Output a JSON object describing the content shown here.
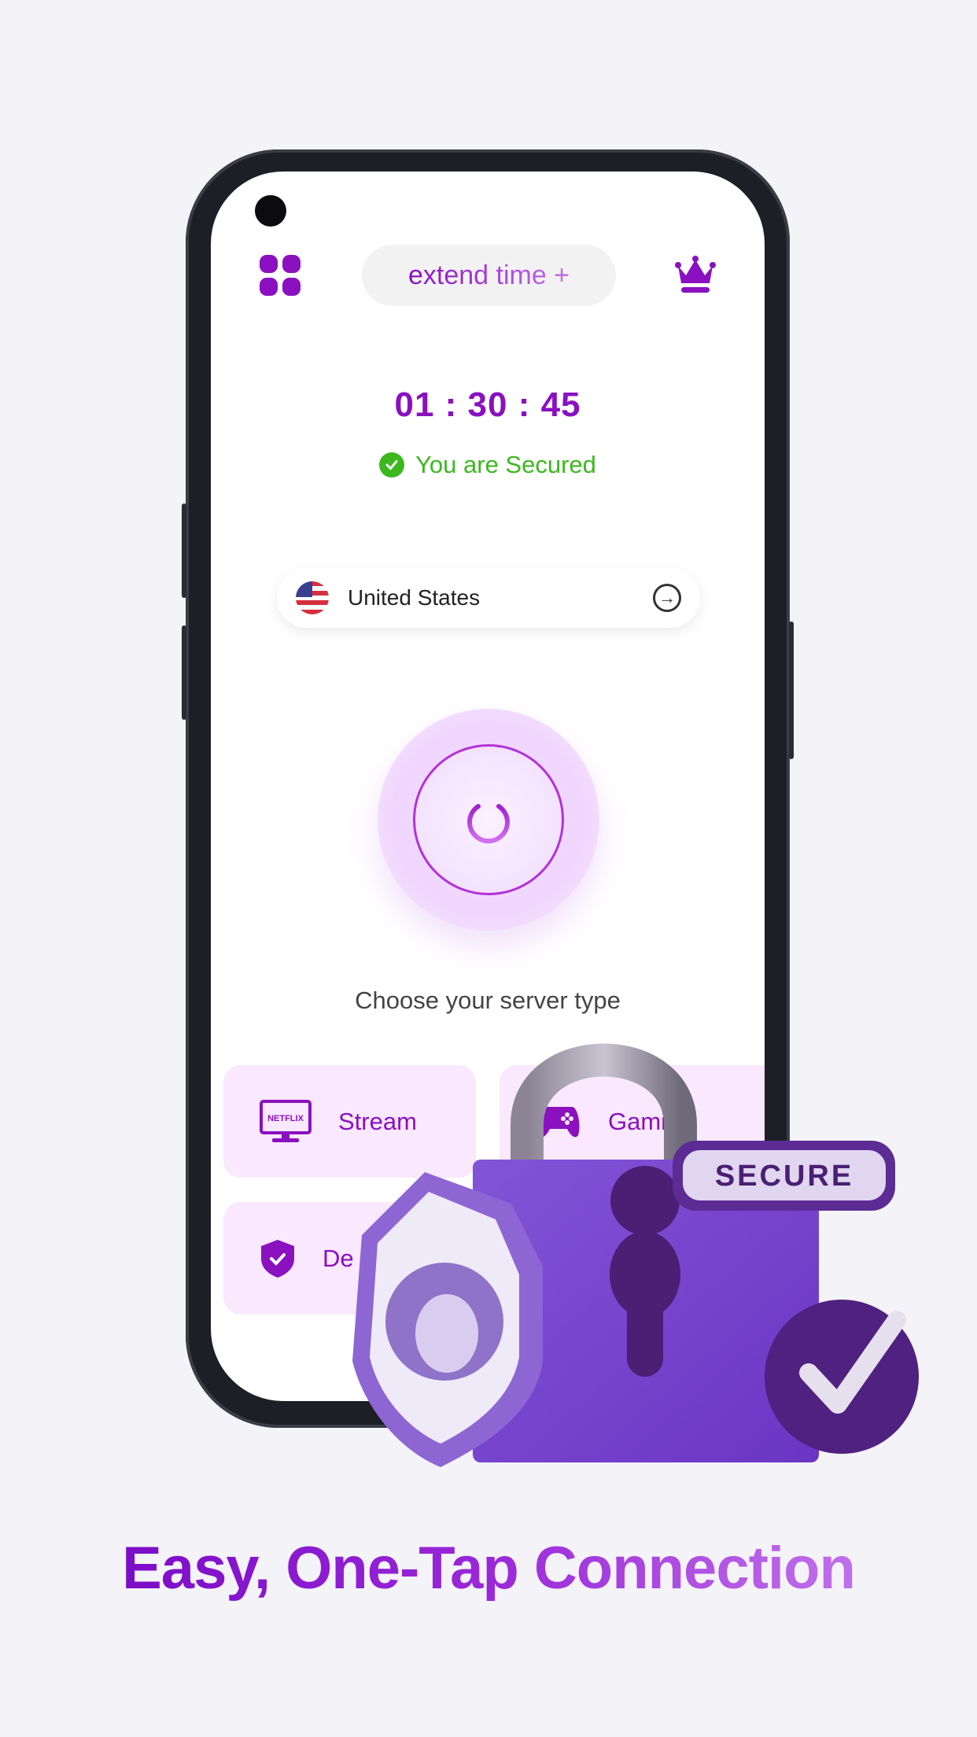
{
  "header": {
    "menu_icon": "grid-icon",
    "extend_time_label": "extend time +",
    "premium_icon": "crown-icon"
  },
  "timer": "01 : 30 : 45",
  "status": {
    "text": "You are Secured",
    "icon": "check-circle-icon",
    "color": "#3cb81e"
  },
  "location": {
    "country": "United States",
    "flag": "us-flag-icon",
    "action_icon": "arrow-right-circle-icon"
  },
  "power": {
    "icon": "power-icon"
  },
  "server_type": {
    "prompt": "Choose your server type",
    "options": [
      {
        "label": "Stream",
        "icon": "netflix-tv-icon"
      },
      {
        "label": "Gaming",
        "icon": "gamepad-icon"
      },
      {
        "label": "De",
        "icon": "shield-check-icon"
      }
    ]
  },
  "illustration": {
    "tag_text": "SECURE"
  },
  "headline": "Easy, One-Tap Connection",
  "colors": {
    "accent": "#8a10c0",
    "success": "#3cb81e",
    "card_bg": "#f9e8fe",
    "page_bg": "#f4f3f8"
  }
}
